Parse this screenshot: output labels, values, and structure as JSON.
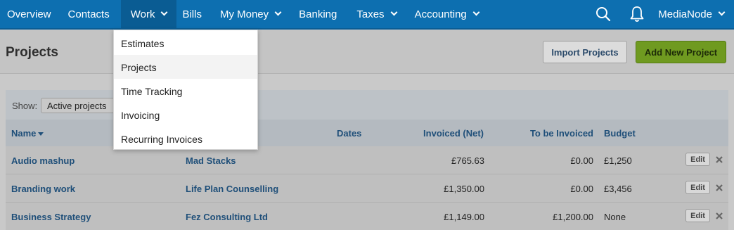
{
  "nav": {
    "items": [
      {
        "label": "Overview",
        "caret": false
      },
      {
        "label": "Contacts",
        "caret": false
      },
      {
        "label": "Work",
        "caret": true,
        "active": true
      },
      {
        "label": "Bills",
        "caret": false
      },
      {
        "label": "My Money",
        "caret": true
      },
      {
        "label": "Banking",
        "caret": false
      },
      {
        "label": "Taxes",
        "caret": true
      },
      {
        "label": "Accounting",
        "caret": true
      }
    ],
    "account_label": "MediaNode",
    "icons": [
      "search-icon",
      "bell-icon"
    ]
  },
  "page": {
    "title": "Projects",
    "import_button": "Import Projects",
    "add_button": "Add New Project"
  },
  "filter": {
    "show_label": "Show:",
    "show_value": "Active projects"
  },
  "table": {
    "headers": {
      "name": "Name",
      "contact": "",
      "dates": "Dates",
      "invoiced": "Invoiced (Net)",
      "to_be_invoiced": "To be Invoiced",
      "budget": "Budget"
    },
    "rows": [
      {
        "name": "Audio mashup",
        "contact": "Mad Stacks",
        "dates": "",
        "invoiced": "£765.63",
        "to_be_invoiced": "£0.00",
        "budget": "£1,250",
        "edit": "Edit"
      },
      {
        "name": "Branding work",
        "contact": "Life Plan Counselling",
        "dates": "",
        "invoiced": "£1,350.00",
        "to_be_invoiced": "£0.00",
        "budget": "£3,456",
        "edit": "Edit"
      },
      {
        "name": "Business Strategy",
        "contact": "Fez Consulting Ltd",
        "dates": "",
        "invoiced": "£1,149.00",
        "to_be_invoiced": "£1,200.00",
        "budget": "None",
        "edit": "Edit"
      }
    ]
  },
  "dropdown": {
    "items": [
      "Estimates",
      "Projects",
      "Time Tracking",
      "Invoicing",
      "Recurring Invoices"
    ],
    "highlighted": "Projects"
  },
  "colors": {
    "nav_bg": "#0d6fb0",
    "link": "#1f4f79",
    "add_button": "#6f9a20"
  }
}
